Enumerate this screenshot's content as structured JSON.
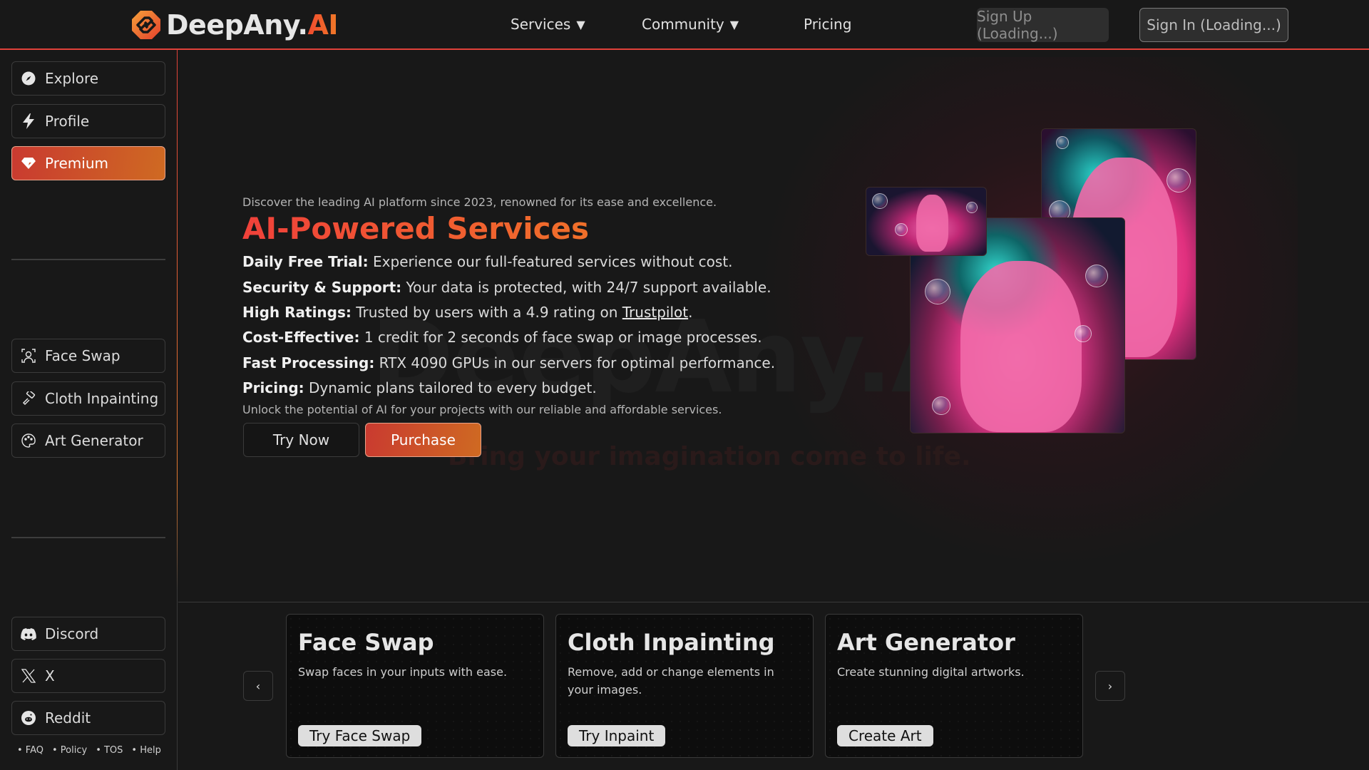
{
  "header": {
    "brand_main": "DeepAny.",
    "brand_accent": "AI",
    "nav": [
      {
        "label": "Services",
        "caret": "▼"
      },
      {
        "label": "Community",
        "caret": "▼"
      },
      {
        "label": "Pricing"
      }
    ],
    "sign_up": "Sign Up (Loading...)",
    "sign_in": "Sign In (Loading...)"
  },
  "sidebar": {
    "top_items": [
      {
        "label": "Explore",
        "icon": "compass-icon"
      },
      {
        "label": "Profile",
        "icon": "lightning-icon"
      },
      {
        "label": "Premium",
        "icon": "gem-icon",
        "active": true
      }
    ],
    "service_items": [
      {
        "label": "Face Swap",
        "icon": "face-scan-icon"
      },
      {
        "label": "Cloth Inpainting",
        "icon": "paint-roller-icon"
      },
      {
        "label": "Art Generator",
        "icon": "palette-icon"
      }
    ],
    "social_items": [
      {
        "label": "Discord",
        "icon": "discord-icon"
      },
      {
        "label": "X",
        "icon": "x-logo-icon"
      },
      {
        "label": "Reddit",
        "icon": "reddit-icon"
      }
    ],
    "footer_links": [
      "• FAQ",
      "• Policy",
      "• TOS",
      "• Help"
    ]
  },
  "hero": {
    "intro": "Discover the leading AI platform since 2023, renowned for its ease and excellence.",
    "title": "AI-Powered Services",
    "features": [
      {
        "label": "Daily Free Trial:",
        "text": " Experience our full-featured services without cost."
      },
      {
        "label": "Security & Support:",
        "text": " Your data is protected, with 24/7 support available."
      },
      {
        "label": "High Ratings:",
        "text": " Trusted by users with a 4.9 rating on ",
        "link": "Trustpilot",
        "after": "."
      },
      {
        "label": "Cost-Effective:",
        "text": " 1 credit for 2 seconds of face swap or image processes."
      },
      {
        "label": "Fast Processing:",
        "text": " RTX 4090 GPUs in our servers for optimal performance."
      },
      {
        "label": "Pricing:",
        "text": " Dynamic plans tailored to every budget."
      }
    ],
    "outro": "Unlock the potential of AI for your projects with our reliable and affordable services.",
    "try_now": "Try Now",
    "purchase": "Purchase",
    "watermark": "DeepAny.AI",
    "watermark_sub": "Bring your imagination come to life."
  },
  "services": {
    "prev": "‹",
    "next": "›",
    "cards": [
      {
        "title": "Face Swap",
        "desc": "Swap faces in your inputs with ease.",
        "button": "Try Face Swap"
      },
      {
        "title": "Cloth Inpainting",
        "desc": "Remove, add or change elements in your images.",
        "button": "Try Inpaint"
      },
      {
        "title": "Art Generator",
        "desc": "Create stunning digital artworks.",
        "button": "Create Art"
      }
    ]
  },
  "colors": {
    "accent_red": "#e0413a",
    "accent_orange": "#cf6a22",
    "background": "#181818"
  }
}
